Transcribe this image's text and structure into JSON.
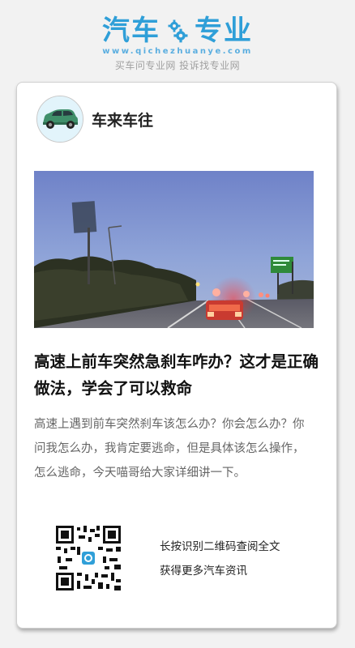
{
  "brand": {
    "name_left": "汽车",
    "name_right": "专业",
    "url": "www.qichezhuanye.com",
    "slogan": "买车问专业网 投诉找专业网",
    "logo_icon": "gears-icon",
    "color": "#2f9fd8"
  },
  "article": {
    "author_name": "车来车往",
    "author_avatar_icon": "car-avatar-icon",
    "cover_image": "highway-traffic-photo",
    "title": "高速上前车突然急刹车咋办？这才是正确做法，学会了可以救命",
    "summary": "高速上遇到前车突然刹车该怎么办？你会怎么办？你问我怎么办，我肯定要逃命，但是具体该怎么操作，怎么逃命，今天喵哥给大家详细讲一下。"
  },
  "share": {
    "qr_icon": "qr-code-icon",
    "caption_line1": "长按识别二维码查阅全文",
    "caption_line2": "获得更多汽车资讯"
  }
}
